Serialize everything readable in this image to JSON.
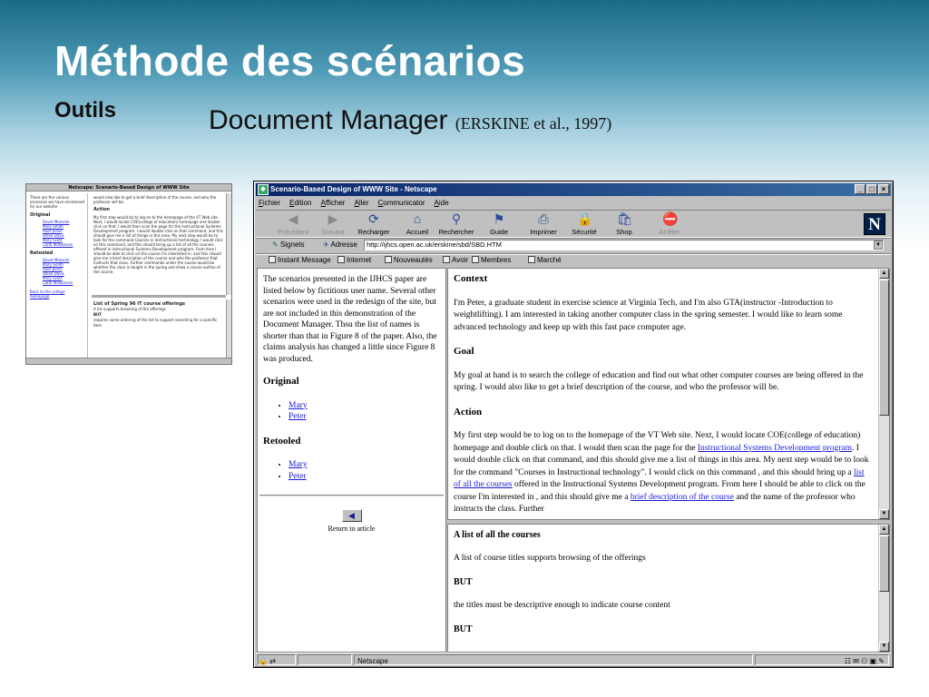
{
  "slide": {
    "title": "Méthode des scénarios",
    "subtitle": "Outils",
    "doc_title": "Document Manager",
    "citation": "(ERSKINE et al., 1997)"
  },
  "thumbnail": {
    "title": "Netscape: Scenario-Based Design of WWW Site",
    "left_intro": "There are the various scenarios we have envisioned for our website",
    "original_heading": "Original",
    "original_items": [
      "David Malcolm",
      "Mary Smith",
      "Rose Jones",
      "Steve Davis",
      "Mary Scott",
      "Carol Williamson"
    ],
    "retooled_heading": "Retooled",
    "retooled_items": [
      "David Malcolm",
      "Mary Smith",
      "Rose Jones",
      "Steve Davis",
      "Mary Scott",
      "Carol Williamson"
    ],
    "back_link": "Back to the college homepage",
    "right_intro": "would also like to get a brief description of the course, and who the professor will be.",
    "action_heading": "Action",
    "action_text": "My first step would be to log on to the homepage of the VT Web site. Next, I would locate COE(college of education) homepage and double click on that. I would then scan the page for the Instructional Systems Development program. I would double click on that command, and this should give me a list of things in this area. My next step would be to look for the command Courses in Instructional technology. I would click on this command, and this should bring up a list of all the courses offered in Instructional Systems Development program. From here I should be able to click on the course I'm interested in, and this should give me a brief description of the course and who the professor that instructs that class. Further commands under the course would be whether the class is taught in the spring and show a course outline of the course.",
    "lower_heading": "List of Spring 96 IT course offerings",
    "lower_line1": "A list supports browsing of the offerings",
    "lower_but": "BUT",
    "lower_line2": "requires some ordering of the list to support searching for a specific item"
  },
  "window": {
    "title": "Scenario-Based Design of WWW Site - Netscape",
    "controls": [
      "_",
      "□",
      "×"
    ],
    "menu": [
      "Fichier",
      "Edition",
      "Afficher",
      "Aller",
      "Communicator",
      "Aide"
    ],
    "toolbar": [
      {
        "label": "Précédent",
        "icon": "back-arrow-icon",
        "glyph": "◀",
        "enabled": false
      },
      {
        "label": "Suivant",
        "icon": "forward-arrow-icon",
        "glyph": "▶",
        "enabled": false
      },
      {
        "label": "Recharger",
        "icon": "reload-icon",
        "glyph": "⟳",
        "enabled": true
      },
      {
        "label": "Accueil",
        "icon": "home-icon",
        "glyph": "⌂",
        "enabled": true
      },
      {
        "label": "Rechercher",
        "icon": "search-icon",
        "glyph": "⚲",
        "enabled": true
      },
      {
        "label": "Guide",
        "icon": "guide-icon",
        "glyph": "⚑",
        "enabled": true
      },
      {
        "label": "Imprimer",
        "icon": "printer-icon",
        "glyph": "⎙",
        "enabled": true
      },
      {
        "label": "Sécurité",
        "icon": "lock-icon",
        "glyph": "🔒",
        "enabled": true
      },
      {
        "label": "Shop",
        "icon": "shop-icon",
        "glyph": "🛍",
        "enabled": true
      },
      {
        "label": "Arrêter",
        "icon": "stop-icon",
        "glyph": "⛔",
        "enabled": false
      }
    ],
    "logo": "N",
    "bookmarks_label": "Signets",
    "address_label": "Adresse",
    "url": "http://ijhcs.open.ac.uk/erskine/sbd/SBD.HTM",
    "personal_bar": [
      "Instant Message",
      "Internet",
      "Nouveautés",
      "Avoir",
      "Membres",
      "Marché"
    ],
    "status_text": "Netscape"
  },
  "left_frame": {
    "intro": "The scenarios presented in the IJHCS paper are listed below by fictitious user name. Several other scenarios were used in the redesign of the site, but are not included in this demonstration of the Document Manager. Thsu the list of names is shorter than that in Figure 8 of the paper. Also, the claims analysis has changed a little since Figure 8 was produced.",
    "original_heading": "Original",
    "original_links": [
      "Mary",
      "Peter"
    ],
    "retooled_heading": "Retooled",
    "retooled_links": [
      "Mary",
      "Peter"
    ],
    "back_label": "Return to article"
  },
  "top_frame": {
    "context_heading": "Context",
    "context_text": "I'm Peter, a graduate student in exercise science at Virginia Tech, and I'm also GTA(instructor -Introduction to weightlifting). I am interested in taking another computer class in the spring semester. I would like to learn some advanced technology and keep up with this fast pace computer age.",
    "goal_heading": "Goal",
    "goal_text": "My goal at hand is to search the college of education and find out what other computer courses are being offered in the spring. I would also like to get a brief description of the course, and who the professor will be.",
    "action_heading": "Action",
    "action_p1": "My first step would be to log on to the homepage of the VT Web site. Next, I would locate COE(college of education) homepage and double click on that. I would then scan the page for the ",
    "action_link1": "Instructional Systems Development program",
    "action_p2": ". I would double click on that command, and this should give me a list of things in this area. My next step would be to look for the command \"Courses in Instructional technology\". I would click on this command , and this should bring up a ",
    "action_link2": "list of all the courses",
    "action_p3": " offered in the Instructional Systems Development program. From here I should be able to click on the course I'm interested in , and this should give me a ",
    "action_link3": "brief description of the course",
    "action_p4": " and the name of the professor who instructs the class. Further"
  },
  "bottom_frame": {
    "heading": "A list of all the courses",
    "line1": "A list of course titles supports browsing of the offerings",
    "but1": "BUT",
    "line2": "the titles must be descriptive enough to indicate course content",
    "but2": "BUT"
  }
}
